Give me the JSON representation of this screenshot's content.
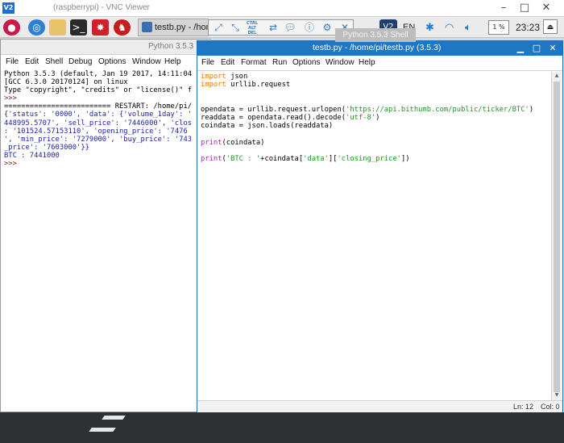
{
  "vnc": {
    "logo": "V2",
    "title": "(raspberrypi) - VNC Viewer",
    "minimize": "–",
    "maximize": "□",
    "close": "✕"
  },
  "taskbar": {
    "launchers": [
      "raspberry-icon",
      "globe-icon",
      "folder-icon",
      "terminal-icon",
      "math-icon",
      "wolfram-icon"
    ],
    "task_label": "testb.py - /hom",
    "lang": "EN",
    "cpu": "1 %",
    "clock": "23:23"
  },
  "vnc_toolbar": {
    "ctrl_alt_del": "CTRL ALT DEL",
    "tooltip": "Python 3.5.3 Shell"
  },
  "shell": {
    "title": "Python 3.5.3",
    "menu": [
      "File",
      "Edit",
      "Shell",
      "Debug",
      "Options",
      "Window",
      "Help"
    ],
    "lines": [
      "Python 3.5.3 (default, Jan 19 2017, 14:11:04",
      "[GCC 6.3.0 20170124] on linux",
      "Type \"copyright\", \"credits\" or \"license()\" f",
      ">>> ",
      "========================= RESTART: /home/pi/",
      "{'status': '0000', 'data': {'volume_1day': '",
      "448995.5707', 'sell_price': '7446000', 'clos",
      ": '101524.57153110', 'opening_price': '7476",
      "', 'min_price': '7279000', 'buy_price': '743",
      "_price': '7603000'}}",
      "BTC : 7441000",
      ">>> "
    ]
  },
  "editor": {
    "title": "testb.py - /home/pi/testb.py (3.5.3)",
    "menu": [
      "File",
      "Edit",
      "Format",
      "Run",
      "Options",
      "Window",
      "Help"
    ],
    "code": {
      "l1_kw": "import",
      "l1_rest": " json",
      "l2_kw": "import",
      "l2_rest": " urllib.request",
      "l5_pre": "opendata = urllib.request.urlopen(",
      "l5_str": "'https://api.bithumb.com/public/ticker/BTC'",
      "l5_post": ")",
      "l6_pre": "readdata = opendata.read().decode(",
      "l6_str": "'utf-8'",
      "l6_post": ")",
      "l7": "coindata = json.loads(readdata)",
      "l9_bi": "print",
      "l9_rest": "(coindata)",
      "l11_bi": "print",
      "l11_a": "(",
      "l11_str1": "'BTC : '",
      "l11_b": "+coindata[",
      "l11_str2": "'data'",
      "l11_c": "][",
      "l11_str3": "'closing_price'",
      "l11_d": "])"
    },
    "status_ln": "Ln: 12",
    "status_col": "Col: 0"
  }
}
